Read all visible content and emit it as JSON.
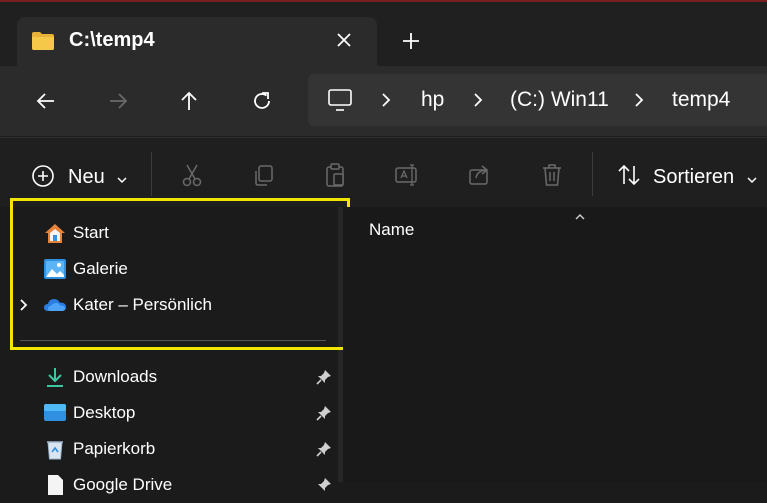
{
  "tab": {
    "title": "C:\\temp4"
  },
  "address": {
    "crumbs": [
      "hp",
      "(C:) Win11",
      "temp4"
    ]
  },
  "toolbar": {
    "new_label": "Neu",
    "sort_label": "Sortieren"
  },
  "sidebar": {
    "items": [
      {
        "label": "Start"
      },
      {
        "label": "Galerie"
      },
      {
        "label": "Kater – Persönlich"
      },
      {
        "label": "Downloads"
      },
      {
        "label": "Desktop"
      },
      {
        "label": "Papierkorb"
      },
      {
        "label": "Google Drive"
      }
    ]
  },
  "content": {
    "column_name": "Name"
  },
  "colors": {
    "highlight": "#f2e600",
    "folder": "#f0c040",
    "accent": "#4cc2ff"
  }
}
